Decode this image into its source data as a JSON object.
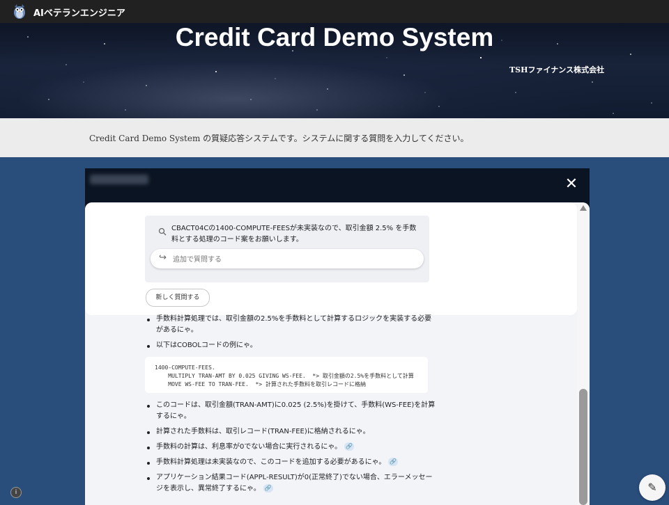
{
  "header": {
    "brand": "AIベテランエンジニア",
    "logo_icon": "owl-logo-icon"
  },
  "hero": {
    "title": "Credit Card Demo System",
    "subtitle": "TSHファイナンス株式会社"
  },
  "description": {
    "text": "Credit Card Demo System の質疑応答システムです。システムに関する質問を入力してください。"
  },
  "modal": {
    "close_icon": "close-icon",
    "question": {
      "search_icon": "search-icon",
      "text": "CBACT04Cの1400-COMPUTE-FEESが未実装なので、取引金額 2.5% を手数料とする処理のコード案をお願いします。"
    },
    "followup": {
      "arrow_icon": "reply-arrow-icon",
      "placeholder": "追加で質問する",
      "value": ""
    },
    "new_question_label": "新しく質問する",
    "answer": {
      "bullets_top": [
        "手数料計算処理では、取引金額の2.5%を手数料として計算するロジックを実装する必要があるにゃ。",
        "以下はCOBOLコードの例にゃ。"
      ],
      "code_lines": [
        "1400-COMPUTE-FEES.",
        "    MULTIPLY TRAN-AMT BY 0.025 GIVING WS-FEE.  *> 取引金額の2.5%を手数料として計算",
        "    MOVE WS-FEE TO TRAN-FEE.  *> 計算された手数料を取引レコードに格納"
      ],
      "bullets_bottom": [
        "このコードは、取引金額(TRAN-AMT)に0.025 (2.5%)を掛けて、手数料(WS-FEE)を計算するにゃ。",
        "計算された手数料は、取引レコード(TRAN-FEE)に格納されるにゃ。",
        "手数料の計算は、利息率が0でない場合に実行されるにゃ。",
        "手数料計算処理は未実装なので、このコードを追加する必要があるにゃ。",
        "アプリケーション結果コード(APPL-RESULT)が0(正常終了)でない場合、エラーメッセージを表示し、異常終了するにゃ。"
      ],
      "link_icon": "link-icon"
    }
  },
  "footer": {
    "info_icon": "info-icon",
    "edit_icon": "pencil-edit-icon"
  },
  "colors": {
    "top_bar": "#212121",
    "page_background": "#2a4e7c",
    "modal_header": "#0b1422",
    "panel": "#f2f4f8"
  }
}
